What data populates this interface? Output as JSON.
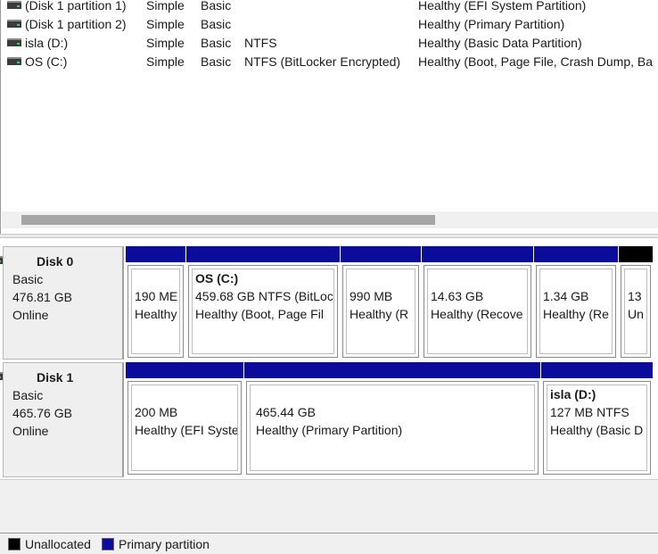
{
  "volumes": [
    {
      "name": "(Disk 1 partition 1)",
      "layout": "Simple",
      "type": "Basic",
      "file_system": "",
      "status": "Healthy (EFI System Partition)"
    },
    {
      "name": "(Disk 1 partition 2)",
      "layout": "Simple",
      "type": "Basic",
      "file_system": "",
      "status": "Healthy (Primary Partition)"
    },
    {
      "name": "isla (D:)",
      "layout": "Simple",
      "type": "Basic",
      "file_system": "NTFS",
      "status": "Healthy (Basic Data Partition)"
    },
    {
      "name": "OS (C:)",
      "layout": "Simple",
      "type": "Basic",
      "file_system": "NTFS (BitLocker Encrypted)",
      "status": "Healthy (Boot, Page File, Crash Dump, Ba"
    }
  ],
  "disks": [
    {
      "title": "Disk 0",
      "type": "Basic",
      "size": "476.81 GB",
      "state": "Online",
      "partitions": [
        {
          "name": "",
          "size": "190 ME",
          "status": "Healthy"
        },
        {
          "name": "OS  (C:)",
          "size": "459.68 GB NTFS (BitLoc",
          "status": "Healthy (Boot, Page Fil"
        },
        {
          "name": "",
          "size": "990 MB",
          "status": "Healthy (R"
        },
        {
          "name": "",
          "size": "14.63 GB",
          "status": "Healthy (Recove"
        },
        {
          "name": "",
          "size": "1.34 GB",
          "status": "Healthy (Re"
        },
        {
          "name": "",
          "size": "13",
          "status": "Un"
        }
      ]
    },
    {
      "title": "Disk 1",
      "type": "Basic",
      "size": "465.76 GB",
      "state": "Online",
      "partitions": [
        {
          "name": "",
          "size": "200 MB",
          "status": "Healthy (EFI Syste"
        },
        {
          "name": "",
          "size": "465.44 GB",
          "status": "Healthy (Primary Partition)"
        },
        {
          "name": "isla  (D:)",
          "size": "127 MB NTFS",
          "status": "Healthy (Basic D"
        }
      ]
    }
  ],
  "legend": [
    {
      "label": "Unallocated",
      "color": "#000000"
    },
    {
      "label": "Primary partition",
      "color": "#0b0b9c"
    }
  ],
  "icons": {
    "drive": "drive-icon"
  }
}
